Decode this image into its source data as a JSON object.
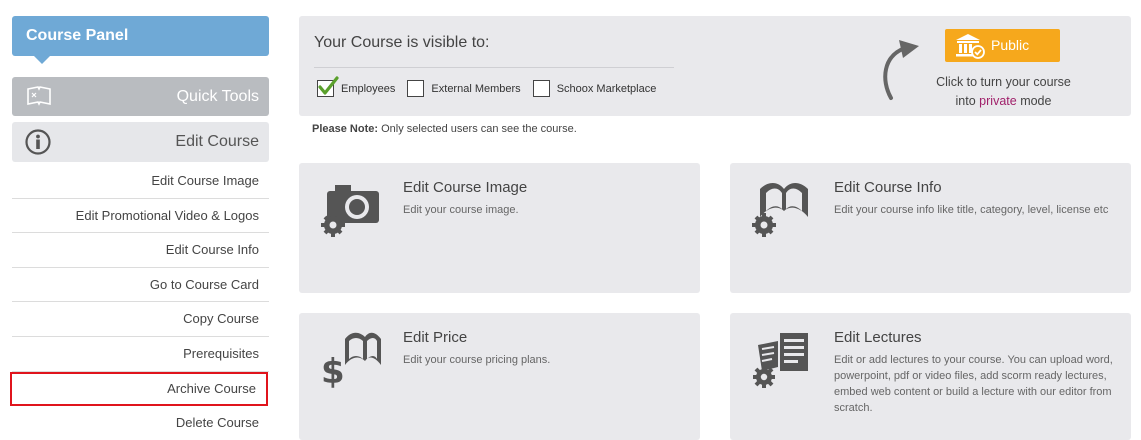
{
  "sidebar": {
    "header": "Course Panel",
    "quick_tools": "Quick Tools",
    "edit_course": "Edit Course",
    "items": [
      {
        "label": "Edit Course Image"
      },
      {
        "label": "Edit Promotional Video & Logos"
      },
      {
        "label": "Edit Course Info"
      },
      {
        "label": "Go to Course Card"
      },
      {
        "label": "Copy Course"
      },
      {
        "label": "Prerequisites"
      },
      {
        "label": "Archive Course"
      },
      {
        "label": "Delete Course"
      }
    ]
  },
  "visibility": {
    "title": "Your Course is visible to:",
    "options": [
      {
        "label": "Employees",
        "checked": true
      },
      {
        "label": "External Members",
        "checked": false
      },
      {
        "label": "Schoox Marketplace",
        "checked": false
      }
    ],
    "public_button": "Public",
    "turn_note_line1": "Click to turn your course",
    "turn_note_into": "into",
    "turn_note_private": "private",
    "turn_note_mode": "mode",
    "note_label": "Please Note:",
    "note_text": "Only selected users can see the course."
  },
  "cards": [
    {
      "title": "Edit Course Image",
      "description": "Edit your course image.",
      "icon": "camera-gear-icon"
    },
    {
      "title": "Edit Course Info",
      "description": "Edit your course info like title, category, level, license etc",
      "icon": "book-gear-icon"
    },
    {
      "title": "Edit Price",
      "description": "Edit your course pricing plans.",
      "icon": "dollar-book-icon"
    },
    {
      "title": "Edit Lectures",
      "description": "Edit or add lectures to your course. You can upload word, powerpoint, pdf or video files, add scorm ready lectures, embed web content or build a lecture with our editor from scratch.",
      "icon": "document-gear-icon"
    }
  ],
  "colors": {
    "header_blue": "#6fa9d6",
    "public_orange": "#f6a81c",
    "highlight_red": "#e0141c",
    "private_purple": "#a0206a",
    "check_green": "#5aa02c"
  }
}
